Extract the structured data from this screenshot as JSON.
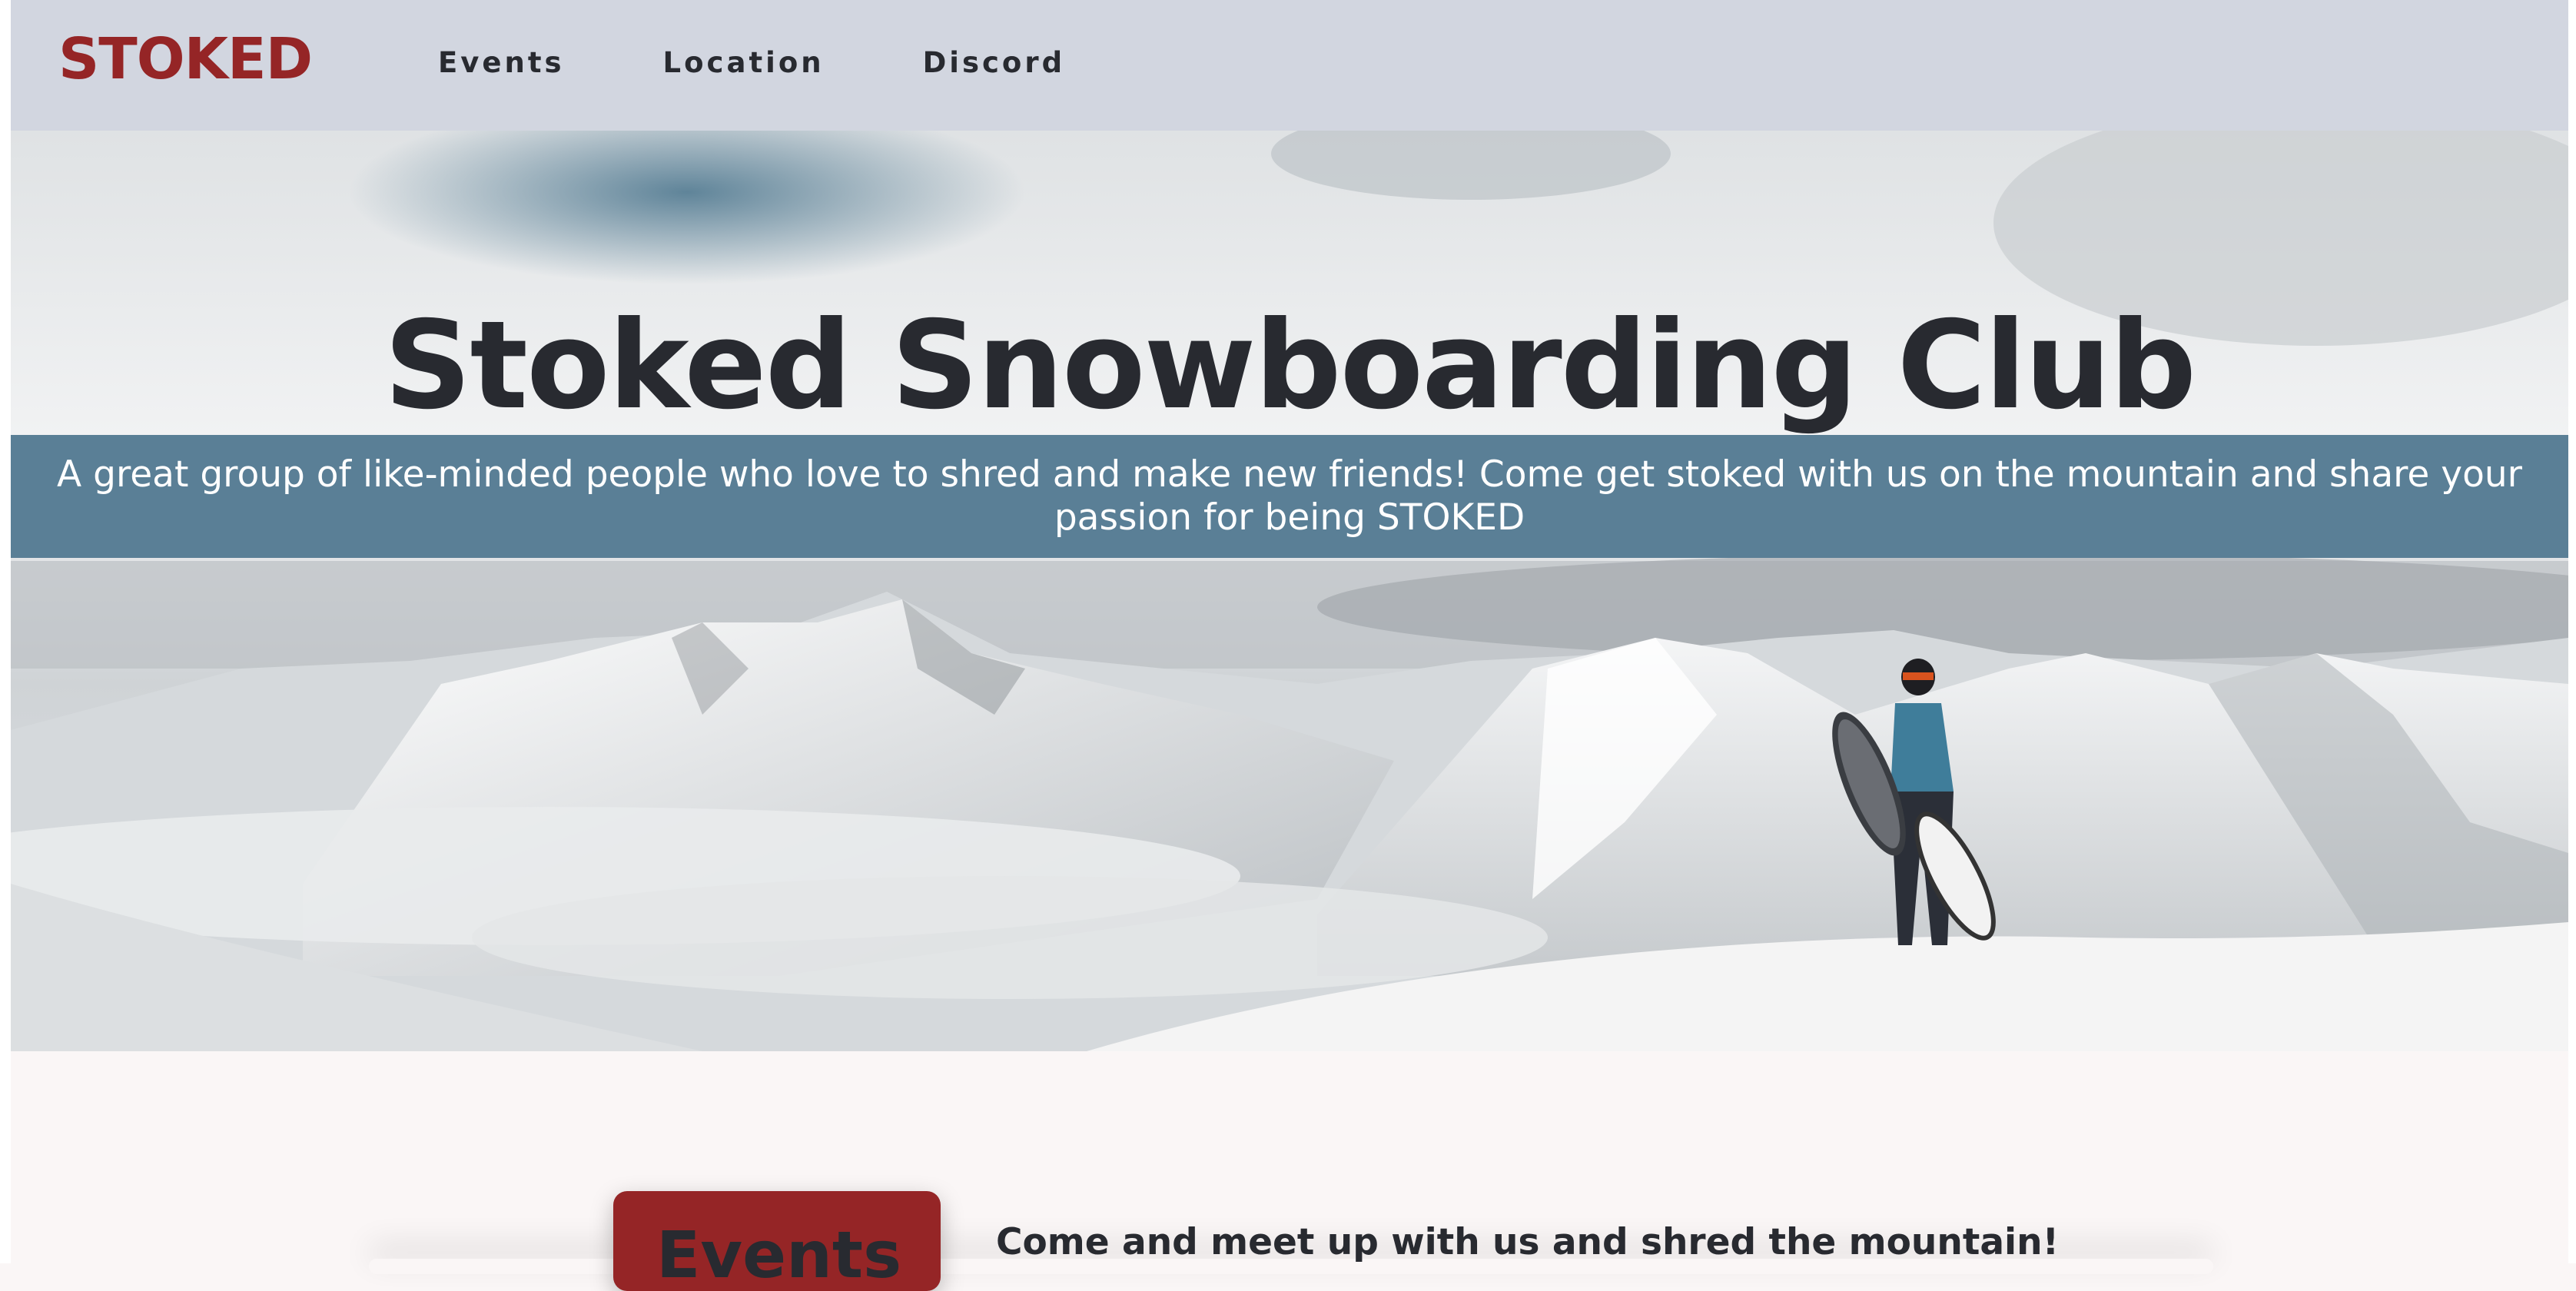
{
  "brand": {
    "logo": "STOKED",
    "color": "#952526"
  },
  "nav": {
    "items": [
      {
        "label": "Events"
      },
      {
        "label": "Location"
      },
      {
        "label": "Discord"
      }
    ]
  },
  "hero": {
    "title": "Stoked Snowboarding Club",
    "tagline": "A great group of like-minded people who love to shred and make new friends! Come get stoked with us on the mountain and share your passion for being STOKED",
    "band_color": "#5a7f96"
  },
  "events": {
    "button_label": "Events",
    "heading": "Come and meet up with us and shred the mountain!"
  },
  "colors": {
    "nav_bg": "#d2d6e0",
    "text_dark": "#282a30",
    "page_bg": "#faf6f6"
  }
}
